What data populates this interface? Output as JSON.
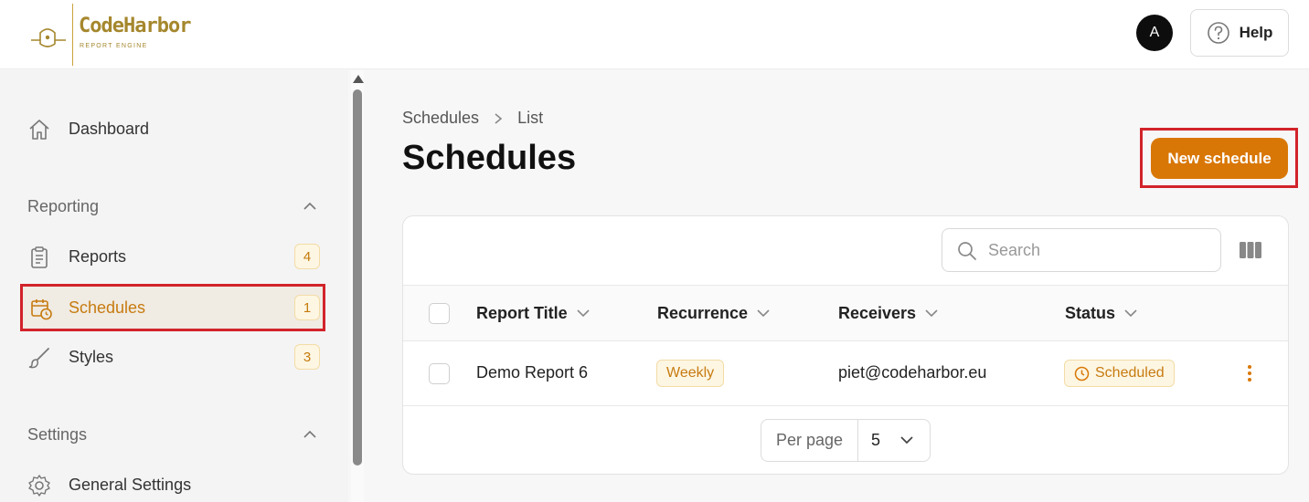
{
  "header": {
    "logo_name": "CodeHarbor",
    "logo_subtitle": "REPORT ENGINE",
    "avatar_initial": "A",
    "help_label": "Help"
  },
  "sidebar": {
    "dashboard_label": "Dashboard",
    "reporting_section": "Reporting",
    "settings_section": "Settings",
    "items": [
      {
        "label": "Reports",
        "count": "4",
        "icon": "clipboard-icon"
      },
      {
        "label": "Schedules",
        "count": "1",
        "icon": "calendar-clock-icon",
        "active": true
      },
      {
        "label": "Styles",
        "count": "3",
        "icon": "brush-icon"
      }
    ],
    "general_settings_label": "General Settings"
  },
  "main": {
    "breadcrumb": [
      "Schedules",
      "List"
    ],
    "title": "Schedules",
    "new_button": "New schedule"
  },
  "table": {
    "search_placeholder": "Search",
    "columns": [
      "Report Title",
      "Recurrence",
      "Receivers",
      "Status"
    ],
    "rows": [
      {
        "title": "Demo Report 6",
        "recurrence": "Weekly",
        "receivers": "piet@codeharbor.eu",
        "status": "Scheduled"
      }
    ],
    "per_page_label": "Per page",
    "per_page_value": "5"
  },
  "colors": {
    "accent": "#d97706",
    "highlight": "#d2232a",
    "badge_bg": "#fdf6e3"
  }
}
